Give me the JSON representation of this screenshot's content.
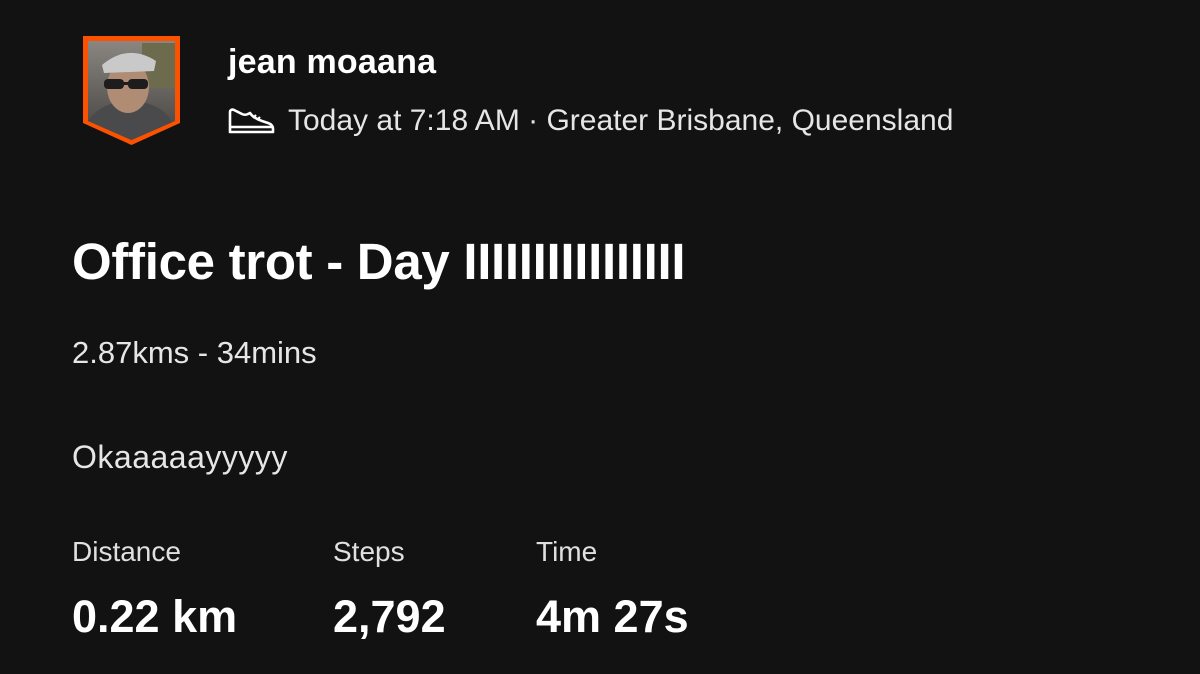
{
  "athlete": {
    "name": "jean moaana",
    "avatar_border_color": "#fc5200"
  },
  "activity": {
    "type_icon": "shoe-icon",
    "meta": "Today at 7:18 AM · Greater Brisbane, Queensland",
    "title": "Office trot - Day IIIIIIIIIIIIIIII",
    "summary": "2.87kms - 34mins",
    "description": "Okaaaaayyyyy"
  },
  "stats": {
    "distance": {
      "label": "Distance",
      "value": "0.22 km"
    },
    "steps": {
      "label": "Steps",
      "value": "2,792"
    },
    "time": {
      "label": "Time",
      "value": "4m 27s"
    }
  },
  "colors": {
    "background": "#121212",
    "text": "#ffffff",
    "accent": "#fc5200"
  }
}
